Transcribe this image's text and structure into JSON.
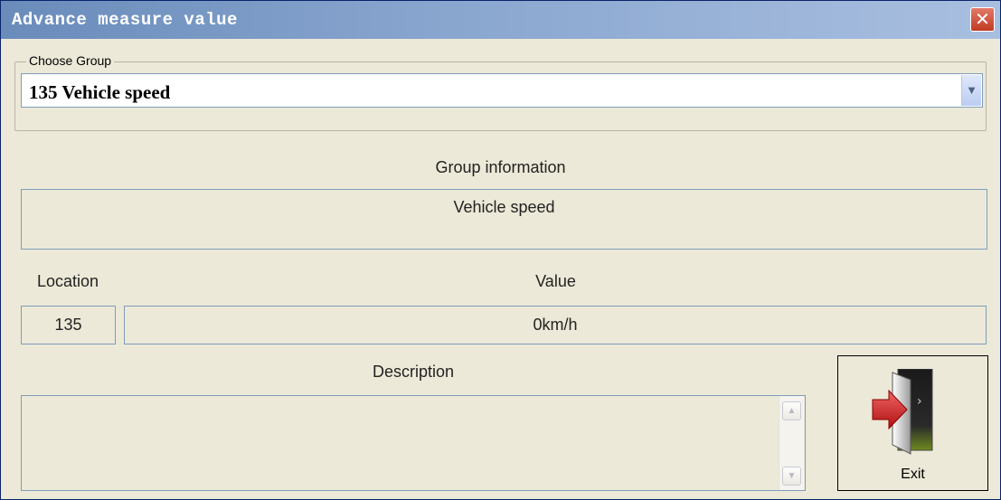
{
  "window": {
    "title": "Advance measure value"
  },
  "choose_group": {
    "legend": "Choose Group",
    "selected": "135 Vehicle speed"
  },
  "group_info": {
    "heading": "Group information",
    "value": "Vehicle speed"
  },
  "location": {
    "label": "Location",
    "value": "135"
  },
  "value": {
    "label": "Value",
    "value": "0km/h"
  },
  "description": {
    "label": "Description",
    "value": ""
  },
  "exit": {
    "label": "Exit"
  },
  "icons": [
    "close-icon",
    "chevron-down-icon",
    "scroll-up-icon",
    "scroll-down-icon",
    "exit-door-icon"
  ]
}
